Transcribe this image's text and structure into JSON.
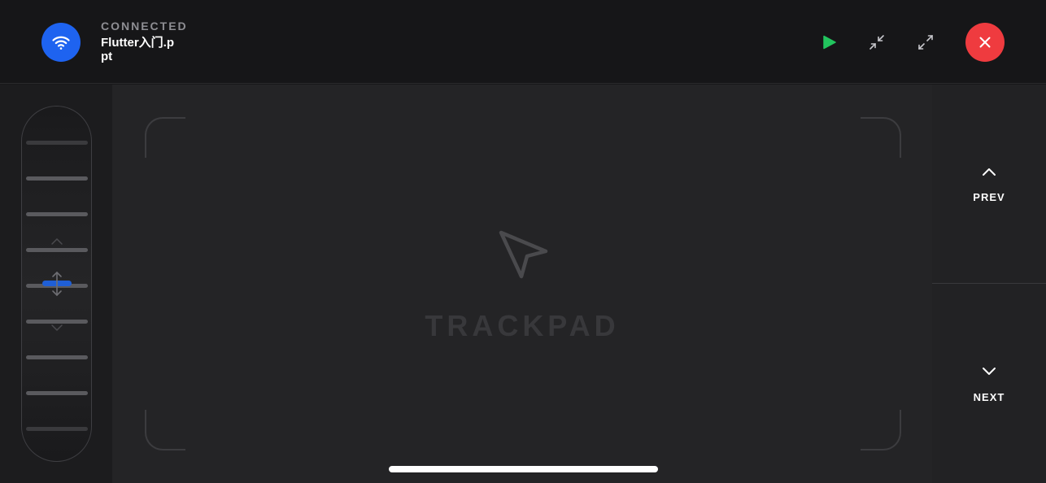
{
  "header": {
    "status": "CONNECTED",
    "file_name": "Flutter入门.ppt",
    "icons": {
      "connection": "wifi-icon",
      "play": "play-icon",
      "collapse": "collapse-icon",
      "expand": "expand-icon",
      "close": "close-icon"
    }
  },
  "trackpad": {
    "label": "TRACKPAD",
    "icon": "cursor-icon"
  },
  "navigation": {
    "prev_label": "PREV",
    "next_label": "NEXT"
  },
  "colors": {
    "accent_blue": "#1e63f0",
    "play_green": "#22c55e",
    "close_red": "#ef3b3f",
    "background": "#242426"
  }
}
